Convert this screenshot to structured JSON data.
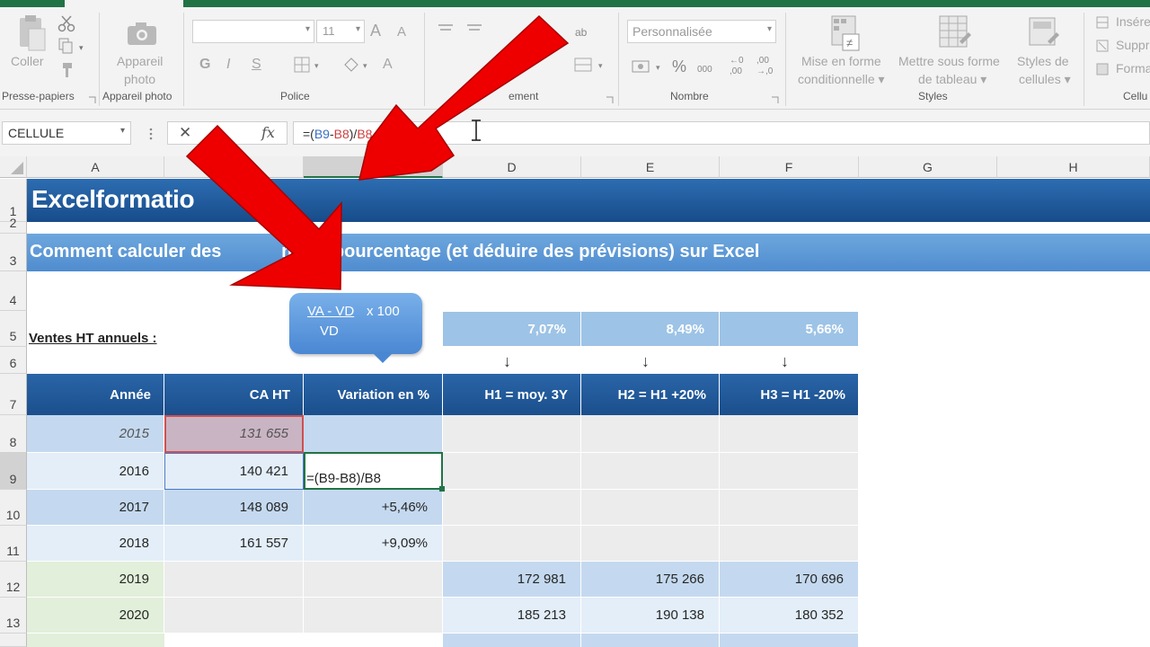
{
  "ribbon": {
    "clipboard": {
      "paste_label": "Coller",
      "group_label": "Presse-papiers"
    },
    "camera": {
      "label_line1": "Appareil",
      "label_line2": "photo",
      "group_label": "Appareil photo"
    },
    "font": {
      "size_value": "11",
      "group_label": "Police",
      "grow_glyph": "A",
      "shrink_glyph": "A",
      "bold_glyph": "G",
      "italic_glyph": "I",
      "underline_glyph": "S",
      "color_glyph": "A"
    },
    "alignment": {
      "group_label": "ement",
      "wrap_glyph": "ab"
    },
    "number": {
      "format_value": "Personnalisée",
      "group_label": "Nombre",
      "percent_glyph": "%",
      "thousands_label": "000",
      "inc_dec_top": "←0",
      "inc_dec_bottom": ",00",
      "dec_dec_top": ",00",
      "dec_dec_bottom": "→,0"
    },
    "styles": {
      "group_label": "Styles",
      "cond_line1": "Mise en forme",
      "cond_line2": "conditionnelle ▾",
      "table_line1": "Mettre sous forme",
      "table_line2": "de tableau ▾",
      "cell_line1": "Styles de",
      "cell_line2": "cellules ▾"
    },
    "cells": {
      "insert": "Insére",
      "delete": "Suppr",
      "format": "Forma",
      "group_label": "Cellu"
    }
  },
  "formula_bar": {
    "name_box": "CELLULE",
    "cancel_glyph": "✕",
    "fx_glyph": "fx",
    "formula_parts": [
      {
        "text": "=(",
        "color": "#333333"
      },
      {
        "text": "B9",
        "color": "#3a6fc4"
      },
      {
        "text": "-",
        "color": "#333333"
      },
      {
        "text": "B8",
        "color": "#d04040"
      },
      {
        "text": ")/",
        "color": "#333333"
      },
      {
        "text": "B8",
        "color": "#d04040"
      }
    ]
  },
  "columns": [
    "A",
    "B",
    "C",
    "D",
    "E",
    "F",
    "G",
    "H"
  ],
  "rows": [
    "1",
    "2",
    "3",
    "4",
    "5",
    "6",
    "7",
    "8",
    "9",
    "10",
    "11",
    "12",
    "13"
  ],
  "sheet": {
    "title": "Excelformatio",
    "subtitle": "Comment calculer des            ns en pourcentage (et déduire des prévisions) sur Excel",
    "ventes_label": "Ventes HT annuels :",
    "rates": [
      "7,07%",
      "8,49%",
      "5,66%"
    ],
    "down_arrow": "↓",
    "headers": [
      "Année",
      "CA HT",
      "Variation en %",
      "H1 = moy. 3Y",
      "H2 = H1 +20%",
      "H3 = H1 -20%"
    ],
    "data_rows": [
      [
        "2015",
        "131 655",
        "",
        "",
        "",
        ""
      ],
      [
        "2016",
        "140 421",
        "=(B9-B8)/B8",
        "",
        "",
        ""
      ],
      [
        "2017",
        "148 089",
        "+5,46%",
        "",
        "",
        ""
      ],
      [
        "2018",
        "161 557",
        "+9,09%",
        "",
        "",
        ""
      ],
      [
        "2019",
        "",
        "",
        "172 981",
        "175 266",
        "170 696"
      ],
      [
        "2020",
        "",
        "",
        "185 213",
        "190 138",
        "180 352"
      ]
    ]
  },
  "callout": {
    "numerator": "VA - VD",
    "times": "x 100",
    "denominator": "VD"
  },
  "colors": {
    "header_blue": "#1f5596",
    "arrow_red": "#ee0000",
    "excel_green": "#217346",
    "selection_green": "#217346"
  }
}
